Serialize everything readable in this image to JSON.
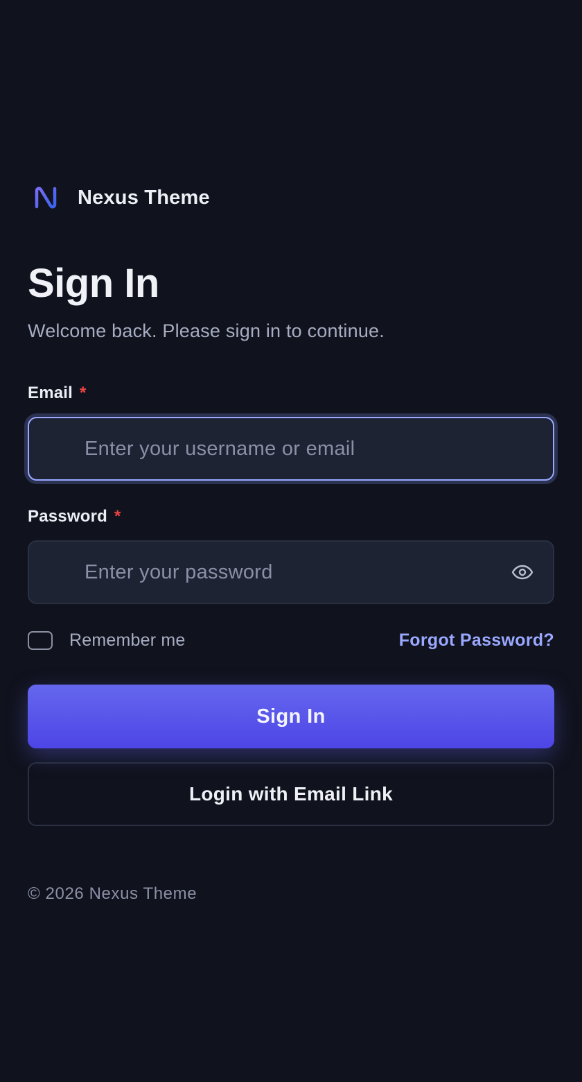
{
  "brand": {
    "logo_icon": "nexus-logo-icon",
    "name": "Nexus Theme",
    "logo_color_start": "#6366f1",
    "logo_color_end": "#4f46e5"
  },
  "header": {
    "title": "Sign In",
    "subtitle": "Welcome back. Please sign in to continue."
  },
  "form": {
    "email": {
      "label": "Email",
      "required_marker": "*",
      "value": "",
      "placeholder": "Enter your username or email"
    },
    "password": {
      "label": "Password",
      "required_marker": "*",
      "value": "",
      "placeholder": "Enter your password",
      "toggle_icon": "eye-icon"
    },
    "remember": {
      "label": "Remember me",
      "checked": false
    },
    "forgot_label": "Forgot Password?",
    "submit_label": "Sign In",
    "email_link_label": "Login with Email Link"
  },
  "footer": {
    "copyright": "© 2026 Nexus Theme"
  },
  "colors": {
    "background": "#10121d",
    "input_background": "#1e2334",
    "accent": "#6366f1",
    "link": "#9aa8ff",
    "required": "#ef4444"
  }
}
